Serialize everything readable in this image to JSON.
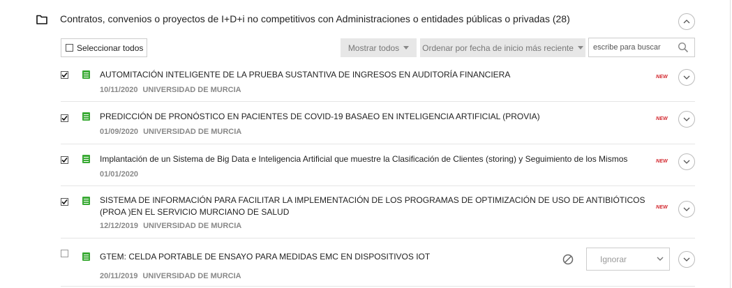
{
  "section": {
    "title": "Contratos, convenios o proyectos de I+D+i no competitivos con Administraciones o entidades públicas o privadas (28)",
    "icon": "folder-icon",
    "collapse_icon": "chevron-up-icon"
  },
  "toolbar": {
    "select_all_label": "Seleccionar todos",
    "select_all_checked": false,
    "show_all_label": "Mostrar todos",
    "sort_label": "Ordenar por fecha de inicio más reciente",
    "search_placeholder": "escribe para buscar"
  },
  "items": [
    {
      "checked": true,
      "title": "AUTOMITACIÓN INTELIGENTE DE LA PRUEBA SUSTANTIVA DE INGRESOS EN AUDITORÍA FINANCIERA",
      "date": "10/11/2020",
      "org": "UNIVERSIDAD DE MURCIA",
      "badge": "NEW"
    },
    {
      "checked": true,
      "title": "PREDICCIÓN DE PRONÓSTICO EN PACIENTES DE COVID-19 BASAEO EN INTELIGENCIA ARTIFICIAL (PROVIA)",
      "date": "01/09/2020",
      "org": "UNIVERSIDAD DE MURCIA",
      "badge": "NEW"
    },
    {
      "checked": true,
      "title": "Implantación de un Sistema de Big Data e Inteligencia Artificial que muestre la Clasificación de Clientes (storing) y Seguimiento de los Mismos",
      "date": "01/01/2020",
      "org": "",
      "badge": "NEW"
    },
    {
      "checked": true,
      "title": "SISTEMA DE INFORMACIÓN PARA FACILITAR LA IMPLEMENTACIÓN DE LOS PROGRAMAS DE OPTIMIZACIÓN DE USO DE ANTIBIÓTICOS (PROA )EN EL SERVICIO MURCIANO DE SALUD",
      "date": "12/12/2019",
      "org": "UNIVERSIDAD DE MURCIA",
      "badge": "NEW"
    },
    {
      "checked": false,
      "title": "GTEM: CELDA PORTABLE DE ENSAYO PARA MEDIDAS EMC EN DISPOSITIVOS IOT",
      "date": "20/11/2019",
      "org": "UNIVERSIDAD DE MURCIA",
      "action_label": "Ignorar"
    }
  ],
  "colors": {
    "badge": "#d2232a",
    "doc_icon": "#3aaa35",
    "meta_text": "#888888"
  }
}
